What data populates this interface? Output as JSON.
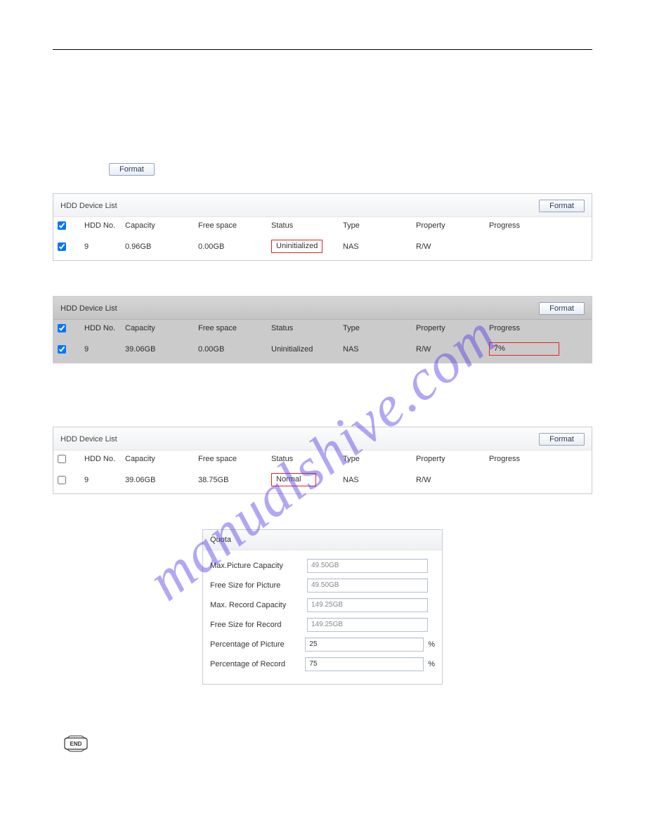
{
  "watermark": "manualshive.com",
  "format_btn_label": "Format",
  "headers": {
    "panel_title": "HDD Device List",
    "hdd_no": "HDD No.",
    "capacity": "Capacity",
    "free_space": "Free space",
    "status": "Status",
    "type": "Type",
    "property": "Property",
    "progress": "Progress"
  },
  "panel1": {
    "row": {
      "no": "9",
      "capacity": "0.96GB",
      "free": "0.00GB",
      "status": "Uninitialized",
      "type": "NAS",
      "property": "R/W",
      "progress": ""
    }
  },
  "panel2": {
    "row": {
      "no": "9",
      "capacity": "39.06GB",
      "free": "0.00GB",
      "status": "Uninitialized",
      "type": "NAS",
      "property": "R/W",
      "progress": "7%"
    }
  },
  "panel3": {
    "row": {
      "no": "9",
      "capacity": "39.06GB",
      "free": "38.75GB",
      "status": "Normal",
      "type": "NAS",
      "property": "R/W",
      "progress": ""
    }
  },
  "quota": {
    "title": "Quota",
    "rows": {
      "max_pic_cap": {
        "label": "Max.Picture Capacity",
        "value": "49.50GB"
      },
      "free_pic": {
        "label": "Free Size for Picture",
        "value": "49.50GB"
      },
      "max_rec_cap": {
        "label": "Max. Record Capacity",
        "value": "149.25GB"
      },
      "free_rec": {
        "label": "Free Size for Record",
        "value": "149.25GB"
      },
      "pct_pic": {
        "label": "Percentage of Picture",
        "value": "25",
        "suffix": "%"
      },
      "pct_rec": {
        "label": "Percentage of Record",
        "value": "75",
        "suffix": "%"
      }
    }
  },
  "end_label": "END"
}
